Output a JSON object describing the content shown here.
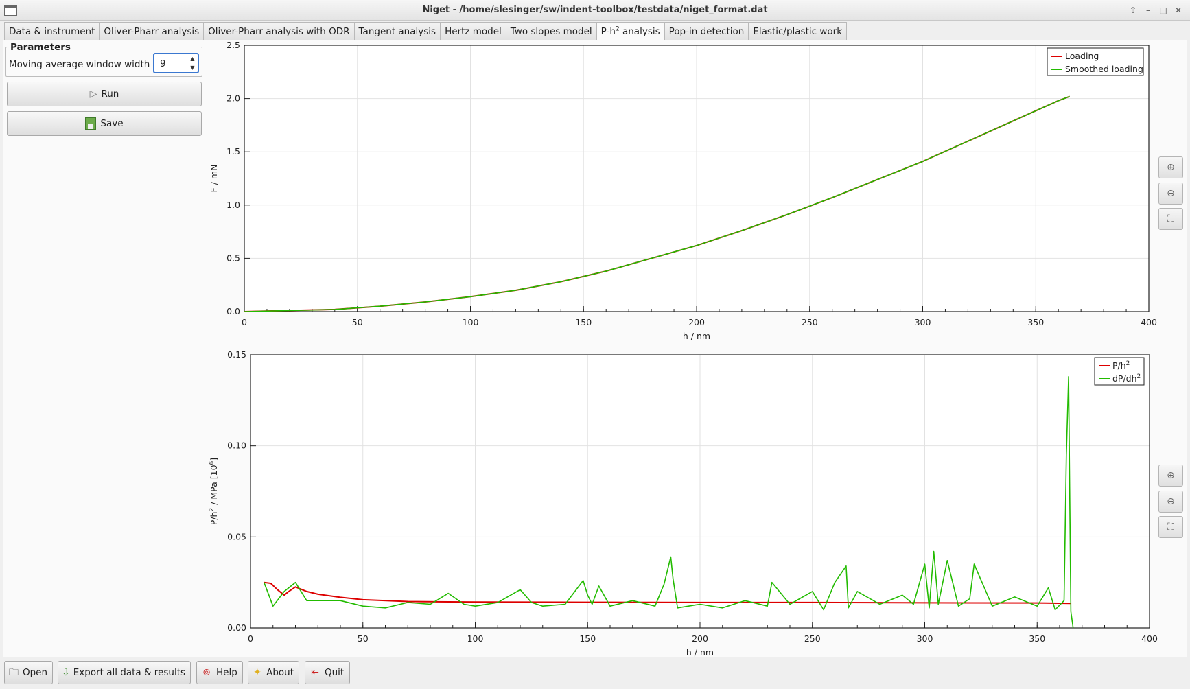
{
  "window": {
    "title": "Niget - /home/slesinger/sw/indent-toolbox/testdata/niget_format.dat",
    "controls": [
      "⇧",
      "–",
      "□",
      "✕"
    ]
  },
  "tabs": [
    {
      "label": "Data & instrument"
    },
    {
      "label": "Oliver-Pharr analysis"
    },
    {
      "label": "Oliver-Pharr analysis with ODR"
    },
    {
      "label": "Tangent analysis"
    },
    {
      "label": "Hertz model"
    },
    {
      "label": "Two slopes model"
    },
    {
      "label_main": "P-h",
      "label_sup": "2",
      "label_tail": " analysis",
      "active": true
    },
    {
      "label": "Pop-in detection"
    },
    {
      "label": "Elastic/plastic work"
    }
  ],
  "parameters": {
    "title": "Parameters",
    "window_label": "Moving average window width",
    "window_value": "9",
    "spin_up": "▲",
    "spin_down": "▼"
  },
  "buttons": {
    "run": "Run",
    "save": "Save",
    "play_glyph": "▷"
  },
  "zoom": {
    "zoom_in": "⊕",
    "zoom_out": "⊖",
    "zoom_fit": "⛶"
  },
  "bottom": {
    "open": "Open",
    "export": "Export all data & results",
    "help": "Help",
    "about": "About",
    "quit": "Quit"
  },
  "colors": {
    "red": "#dd0000",
    "green": "#22bb00",
    "accent": "#3b78d0"
  },
  "chart_data": [
    {
      "type": "line",
      "xlabel": "h / nm",
      "ylabel": "F / mN",
      "xlim": [
        0,
        400
      ],
      "ylim": [
        0,
        2.5
      ],
      "xticks": [
        0,
        50,
        100,
        150,
        200,
        250,
        300,
        350,
        400
      ],
      "yticks": [
        0.0,
        0.5,
        1.0,
        1.5,
        2.0,
        2.5
      ],
      "ytick_labels": [
        "0.0",
        "0.5",
        "1.0",
        "1.5",
        "2.0",
        "2.5"
      ],
      "grid": true,
      "legend_position": "top-right",
      "series": [
        {
          "name": "Loading",
          "color": "#dd0000",
          "x": [
            0,
            20,
            40,
            60,
            80,
            100,
            120,
            140,
            160,
            180,
            200,
            220,
            240,
            260,
            280,
            300,
            320,
            340,
            360,
            365
          ],
          "y": [
            0.0,
            0.01,
            0.02,
            0.05,
            0.09,
            0.14,
            0.2,
            0.28,
            0.38,
            0.5,
            0.62,
            0.76,
            0.91,
            1.07,
            1.24,
            1.41,
            1.6,
            1.79,
            1.98,
            2.02
          ]
        },
        {
          "name": "Smoothed loading",
          "color": "#22bb00",
          "x": [
            0,
            20,
            40,
            60,
            80,
            100,
            120,
            140,
            160,
            180,
            200,
            220,
            240,
            260,
            280,
            300,
            320,
            340,
            360,
            365
          ],
          "y": [
            0.0,
            0.01,
            0.02,
            0.05,
            0.09,
            0.14,
            0.2,
            0.28,
            0.38,
            0.5,
            0.62,
            0.76,
            0.91,
            1.07,
            1.24,
            1.41,
            1.6,
            1.79,
            1.98,
            2.02
          ]
        }
      ]
    },
    {
      "type": "line",
      "xlabel": "h / nm",
      "ylabel_main": "P/h",
      "ylabel_sup": "2",
      "ylabel_tail": " / MPa [10",
      "ylabel_sup2": "6",
      "ylabel_end": "]",
      "xlim": [
        0,
        400
      ],
      "ylim": [
        0,
        0.15
      ],
      "xticks": [
        0,
        50,
        100,
        150,
        200,
        250,
        300,
        350,
        400
      ],
      "yticks": [
        0.0,
        0.05,
        0.1,
        0.15
      ],
      "ytick_labels": [
        "0.00",
        "0.05",
        "0.10",
        "0.15"
      ],
      "grid": true,
      "legend_position": "top-right",
      "series": [
        {
          "name_main": "P/h",
          "name_sup": "2",
          "color": "#dd0000",
          "x": [
            6,
            9,
            12,
            15,
            17,
            20,
            25,
            30,
            40,
            50,
            70,
            100,
            150,
            200,
            250,
            300,
            350,
            365
          ],
          "y": [
            0.025,
            0.0245,
            0.021,
            0.018,
            0.02,
            0.0225,
            0.02,
            0.0185,
            0.0168,
            0.0155,
            0.0145,
            0.0142,
            0.0141,
            0.014,
            0.014,
            0.0138,
            0.0137,
            0.0135
          ]
        },
        {
          "name_main": "dP/dh",
          "name_sup": "2",
          "color": "#22bb00",
          "x": [
            6,
            10,
            15,
            20,
            25,
            30,
            40,
            50,
            60,
            70,
            80,
            88,
            95,
            100,
            110,
            120,
            125,
            130,
            140,
            148,
            150,
            152,
            155,
            160,
            170,
            180,
            184,
            187,
            188,
            190,
            200,
            210,
            220,
            230,
            232,
            240,
            250,
            255,
            260,
            265,
            266,
            270,
            280,
            290,
            295,
            300,
            302,
            304,
            306,
            310,
            315,
            320,
            322,
            330,
            340,
            350,
            355,
            358,
            362,
            363,
            364,
            365,
            366
          ],
          "y": [
            0.025,
            0.012,
            0.02,
            0.025,
            0.015,
            0.015,
            0.015,
            0.012,
            0.011,
            0.014,
            0.013,
            0.019,
            0.013,
            0.012,
            0.014,
            0.021,
            0.014,
            0.012,
            0.013,
            0.026,
            0.018,
            0.013,
            0.023,
            0.012,
            0.015,
            0.012,
            0.024,
            0.039,
            0.027,
            0.011,
            0.013,
            0.011,
            0.015,
            0.012,
            0.025,
            0.013,
            0.02,
            0.01,
            0.025,
            0.034,
            0.011,
            0.02,
            0.013,
            0.018,
            0.013,
            0.035,
            0.011,
            0.042,
            0.013,
            0.037,
            0.012,
            0.016,
            0.035,
            0.012,
            0.017,
            0.012,
            0.022,
            0.01,
            0.015,
            0.095,
            0.138,
            0.009,
            0.0
          ]
        }
      ]
    }
  ]
}
